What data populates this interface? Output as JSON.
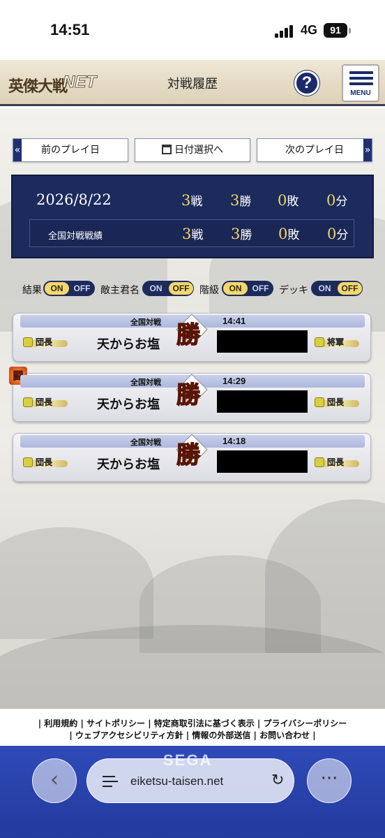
{
  "status_bar": {
    "time": "14:51",
    "network": "4G",
    "battery": "91"
  },
  "header": {
    "logo_text": "英傑大戦",
    "logo_net": "NET",
    "title": "対戦履歴",
    "help_label": "?",
    "menu_label": "MENU"
  },
  "day_nav": {
    "prev_label": "前のプレイ日",
    "date_select_label": "日付選択へ",
    "next_label": "次のプレイ日",
    "prev_arrow": "«",
    "next_arrow": "»"
  },
  "summary": {
    "date": "2026/8/22",
    "battles": "3",
    "battles_unit": "戦",
    "wins": "3",
    "wins_unit": "勝",
    "losses": "0",
    "losses_unit": "敗",
    "draws": "0",
    "draws_unit": "分",
    "national": {
      "label": "全国対戦戦績",
      "battles": "3",
      "battles_unit": "戦",
      "wins": "3",
      "wins_unit": "勝",
      "losses": "0",
      "losses_unit": "敗",
      "draws": "0",
      "draws_unit": "分"
    }
  },
  "toggles": [
    {
      "label": "結果",
      "on": "ON",
      "off": "OFF",
      "state": "on"
    },
    {
      "label": "敵主君名",
      "on": "ON",
      "off": "OFF",
      "state": "off"
    },
    {
      "label": "階級",
      "on": "ON",
      "off": "OFF",
      "state": "on"
    },
    {
      "label": "デッキ",
      "on": "ON",
      "off": "OFF",
      "state": "off"
    }
  ],
  "battles": [
    {
      "mode": "全国対戦",
      "time": "14:41",
      "player": "天からお塩",
      "result": "勝",
      "my_rank": "団長",
      "opp_rank": "将軍",
      "tou": ""
    },
    {
      "mode": "全国対戦",
      "time": "14:29",
      "player": "天からお塩",
      "result": "勝",
      "my_rank": "団長",
      "opp_rank": "団長",
      "tou": "闘"
    },
    {
      "mode": "全国対戦",
      "time": "14:18",
      "player": "天からお塩",
      "result": "勝",
      "my_rank": "団長",
      "opp_rank": "団長",
      "tou": ""
    }
  ],
  "footer": {
    "links_row1": "| 利用規約 | サイトポリシー | 特定商取引法に基づく表示 | プライバシーポリシー",
    "links_row2": "| ウェブアクセシビリティ方針 | 情報の外部送信 | お問い合わせ |",
    "brand": "SEGA"
  },
  "browser": {
    "url": "eiketsu-taisen.net",
    "back_label": "‹",
    "more_label": "···"
  },
  "colors": {
    "navy": "#1c2a5c",
    "accent_yellow": "#f2d660",
    "win_red": "#e0451a"
  }
}
